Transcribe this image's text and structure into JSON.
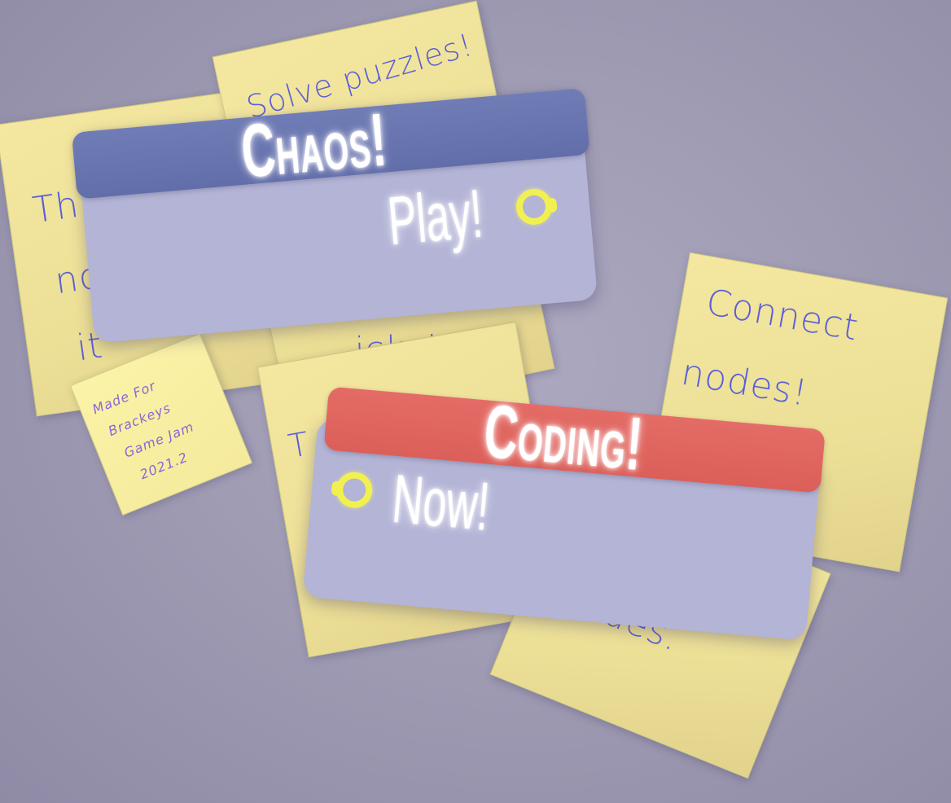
{
  "colors": {
    "background": "#a09cb4",
    "sticky_note": "#ecdf96",
    "note_ink": "#5a5fd8",
    "panel_body": "#b3b4d6",
    "chaos_header": "#6a75ae",
    "coding_header": "#e0625c",
    "ring_accent": "#f2f051",
    "glow_text": "#ffffff"
  },
  "notes": [
    {
      "lines": [
        "Th",
        "no",
        "it'"
      ]
    },
    {
      "lines": [
        "Solve puzzles!",
        "icky!"
      ]
    },
    {
      "lines": [
        "T"
      ]
    },
    {
      "lines": [
        "Connect",
        "nodes!"
      ]
    },
    {
      "lines": [
        "nodes.",
        "es"
      ]
    },
    {
      "lines": [
        "Made For",
        "Brackeys",
        "Game Jam",
        "2021.2"
      ]
    }
  ],
  "chaos_panel": {
    "title": "Chaos!",
    "action_label": "Play!",
    "action_icon": "ring-icon"
  },
  "coding_panel": {
    "title": "Coding!",
    "action_label": "Now!",
    "action_icon": "ring-icon"
  }
}
